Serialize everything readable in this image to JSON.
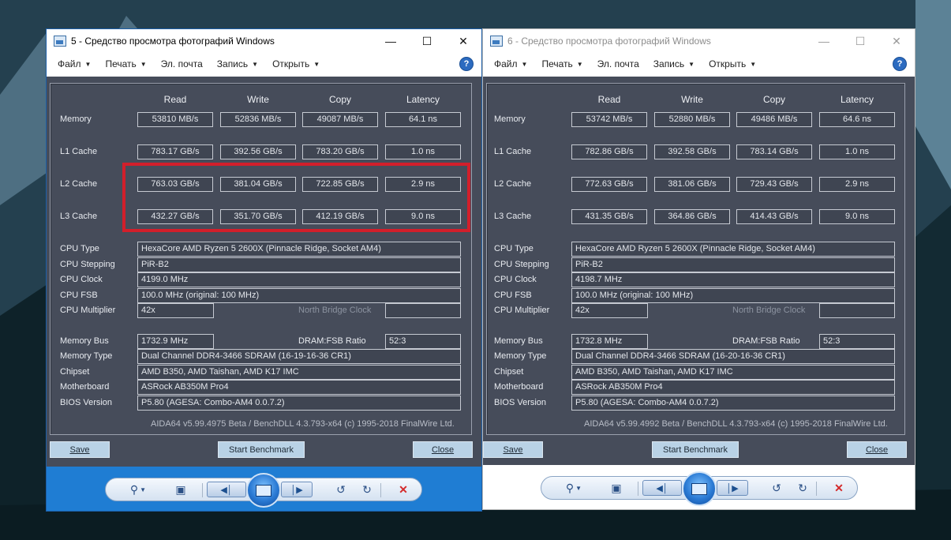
{
  "windows": [
    {
      "title": "5 - Средство просмотра фотографий Windows",
      "menu": [
        "Файл",
        "Печать",
        "Эл. почта",
        "Запись",
        "Открыть"
      ],
      "menu_has_arrow": [
        true,
        true,
        false,
        true,
        true
      ],
      "columns": [
        "Read",
        "Write",
        "Copy",
        "Latency"
      ],
      "bench_rows": [
        {
          "label": "Memory",
          "values": [
            "53810 MB/s",
            "52836 MB/s",
            "49087 MB/s",
            "64.1 ns"
          ]
        },
        {
          "label": "L1 Cache",
          "values": [
            "783.17 GB/s",
            "392.56 GB/s",
            "783.20 GB/s",
            "1.0 ns"
          ]
        },
        {
          "label": "L2 Cache",
          "values": [
            "763.03 GB/s",
            "381.04 GB/s",
            "722.85 GB/s",
            "2.9 ns"
          ]
        },
        {
          "label": "L3 Cache",
          "values": [
            "432.27 GB/s",
            "351.70 GB/s",
            "412.19 GB/s",
            "9.0 ns"
          ]
        }
      ],
      "cpu": {
        "type_label": "CPU Type",
        "type": "HexaCore AMD Ryzen 5 2600X  (Pinnacle Ridge, Socket AM4)",
        "stepping_label": "CPU Stepping",
        "stepping": "PiR-B2",
        "clock_label": "CPU Clock",
        "clock": "4199.0 MHz",
        "fsb_label": "CPU FSB",
        "fsb": "100.0 MHz  (original: 100 MHz)",
        "mult_label": "CPU Multiplier",
        "mult": "42x",
        "nb_label": "North Bridge Clock"
      },
      "mem": {
        "bus_label": "Memory Bus",
        "bus": "1732.9 MHz",
        "ratio_label": "DRAM:FSB Ratio",
        "ratio": "52:3",
        "type_label": "Memory Type",
        "type": "Dual Channel DDR4-3466 SDRAM  (16-19-16-36 CR1)",
        "chipset_label": "Chipset",
        "chipset": "AMD B350, AMD Taishan, AMD K17 IMC",
        "mb_label": "Motherboard",
        "mb": "ASRock AB350M Pro4",
        "bios_label": "BIOS Version",
        "bios": "P5.80  (AGESA: Combo-AM4 0.0.7.2)"
      },
      "footer": "AIDA64 v5.99.4975 Beta / BenchDLL 4.3.793-x64  (c) 1995-2018 FinalWire Ltd.",
      "buttons": {
        "save": "Save",
        "start": "Start Benchmark",
        "close": "Close"
      }
    },
    {
      "title": "6 - Средство просмотра фотографий Windows",
      "menu": [
        "Файл",
        "Печать",
        "Эл. почта",
        "Запись",
        "Открыть"
      ],
      "menu_has_arrow": [
        true,
        true,
        false,
        true,
        true
      ],
      "columns": [
        "Read",
        "Write",
        "Copy",
        "Latency"
      ],
      "bench_rows": [
        {
          "label": "Memory",
          "values": [
            "53742 MB/s",
            "52880 MB/s",
            "49486 MB/s",
            "64.6 ns"
          ]
        },
        {
          "label": "L1 Cache",
          "values": [
            "782.86 GB/s",
            "392.58 GB/s",
            "783.14 GB/s",
            "1.0 ns"
          ]
        },
        {
          "label": "L2 Cache",
          "values": [
            "772.63 GB/s",
            "381.06 GB/s",
            "729.43 GB/s",
            "2.9 ns"
          ]
        },
        {
          "label": "L3 Cache",
          "values": [
            "431.35 GB/s",
            "364.86 GB/s",
            "414.43 GB/s",
            "9.0 ns"
          ]
        }
      ],
      "cpu": {
        "type_label": "CPU Type",
        "type": "HexaCore AMD Ryzen 5 2600X  (Pinnacle Ridge, Socket AM4)",
        "stepping_label": "CPU Stepping",
        "stepping": "PiR-B2",
        "clock_label": "CPU Clock",
        "clock": "4198.7 MHz",
        "fsb_label": "CPU FSB",
        "fsb": "100.0 MHz  (original: 100 MHz)",
        "mult_label": "CPU Multiplier",
        "mult": "42x",
        "nb_label": "North Bridge Clock"
      },
      "mem": {
        "bus_label": "Memory Bus",
        "bus": "1732.8 MHz",
        "ratio_label": "DRAM:FSB Ratio",
        "ratio": "52:3",
        "type_label": "Memory Type",
        "type": "Dual Channel DDR4-3466 SDRAM  (16-20-16-36 CR1)",
        "chipset_label": "Chipset",
        "chipset": "AMD B350, AMD Taishan, AMD K17 IMC",
        "mb_label": "Motherboard",
        "mb": "ASRock AB350M Pro4",
        "bios_label": "BIOS Version",
        "bios": "P5.80  (AGESA: Combo-AM4 0.0.7.2)"
      },
      "footer": "AIDA64 v5.99.4992 Beta / BenchDLL 4.3.793-x64  (c) 1995-2018 FinalWire Ltd.",
      "buttons": {
        "save": "Save",
        "start": "Start Benchmark",
        "close": "Close"
      }
    }
  ],
  "toolbar_icons": [
    "zoom-icon",
    "fit-window-icon",
    "previous-icon",
    "slideshow-icon",
    "next-icon",
    "rotate-left-icon",
    "rotate-right-icon",
    "delete-icon"
  ],
  "colors": {
    "active_title_border": "#1c5fa8",
    "toolbar_active": "#1f7dd3",
    "aida_bg": "#464c5a",
    "highlight": "#d21f2b",
    "button": "#b9d2e6"
  }
}
